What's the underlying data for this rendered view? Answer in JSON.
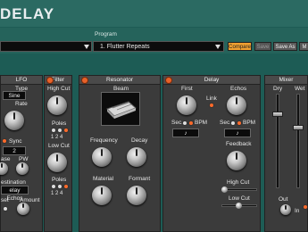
{
  "window": {
    "title": "DELAY"
  },
  "program": {
    "label": "Program",
    "value": "1. Flutter Repeats",
    "compare": "Compare",
    "save": "Save",
    "save_as": "Save As",
    "more": "M"
  },
  "lfo": {
    "title": "LFO",
    "type_label": "Type",
    "type_value": "Sine",
    "rate_label": "Rate",
    "sync_label": "Sync",
    "sync_value": "2",
    "phase_label": "ase",
    "pw_label": "PW",
    "dest_label": "estination",
    "dest_value": "elay Echos",
    "reset_label": "set",
    "amount_label": "Amount"
  },
  "filter": {
    "title": "Filter",
    "high_cut": "High Cut",
    "poles1": "Poles",
    "poles1_opts": "1 2 4",
    "low_cut": "Low Cut",
    "poles2": "Poles",
    "poles2_opts": "1 2 4"
  },
  "resonator": {
    "title": "Resonator",
    "beam": "Beam",
    "frequency": "Frequency",
    "decay": "Decay",
    "material": "Material",
    "formant": "Formant"
  },
  "delay": {
    "title": "Delay",
    "first": "First",
    "echos": "Echos",
    "link": "Link",
    "sec": "Sec.",
    "bpm": "BPM",
    "sec2": "Sec.",
    "bpm2": "BPM",
    "note1": "♪",
    "note2": "♪",
    "feedback": "Feedback",
    "high_cut": "High Cut",
    "low_cut": "Low Cut"
  },
  "mixer": {
    "title": "Mixer",
    "dry": "Dry",
    "wet": "Wet",
    "out": "Out",
    "in": "In"
  },
  "colors": {
    "accent": "#ff6a2a",
    "compare": "#f0a030",
    "background": "#1d5c55",
    "panel": "#3b3b3b"
  }
}
